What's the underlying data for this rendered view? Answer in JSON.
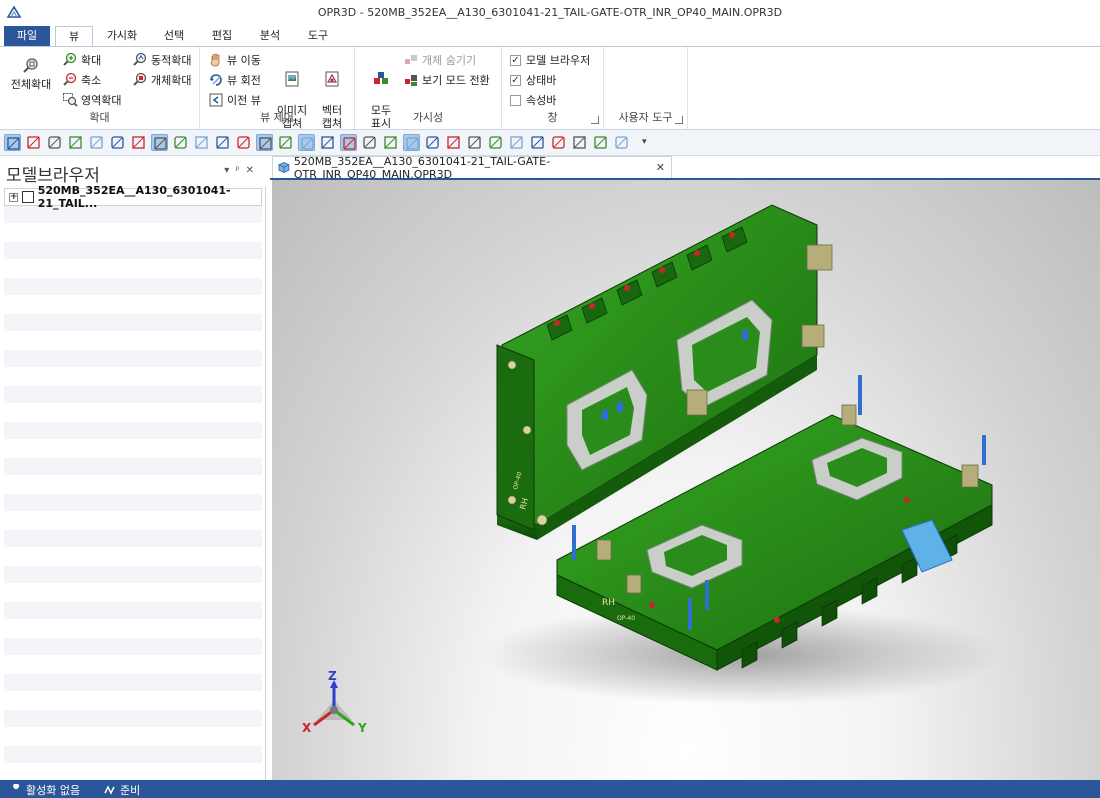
{
  "window": {
    "title": "OPR3D - 520MB_352EA__A130_6301041-21_TAIL-GATE-OTR_INR_OP40_MAIN.OPR3D"
  },
  "ribbon_tabs": [
    {
      "label": "파일"
    },
    {
      "label": "뷰"
    },
    {
      "label": "가시화"
    },
    {
      "label": "선택"
    },
    {
      "label": "편집"
    },
    {
      "label": "분석"
    },
    {
      "label": "도구"
    }
  ],
  "active_tab": "뷰",
  "groups": {
    "zoom": {
      "label": "확대",
      "fit_all": "전체확대",
      "zoom_in": "확대",
      "zoom_out": "축소",
      "zoom_area": "영역확대",
      "dynamic_zoom": "동적확대",
      "zoom_object": "개체확대"
    },
    "view_control": {
      "label": "뷰 제어",
      "pan": "뷰 이동",
      "rotate": "뷰 회전",
      "previous": "이전 뷰",
      "image_capture": "이미지\n캡쳐",
      "vector_capture": "벡터\n캡쳐"
    },
    "visibility": {
      "label": "가시성",
      "show_all": "모두\n표시",
      "hide_object": "개체 숨기기",
      "view_mode": "보기 모드 전환"
    },
    "window": {
      "label": "창",
      "model_browser": "모델 브라우저",
      "model_browser_checked": true,
      "status_bar": "상태바",
      "status_bar_checked": true,
      "property_bar": "속성바",
      "property_bar_checked": false
    },
    "user_tools": {
      "label": "사용자 도구"
    }
  },
  "panel": {
    "title": "모델브라우저",
    "tree_root": "520MB_352EA__A130_6301041-21_TAIL..."
  },
  "document": {
    "tab_label": "520MB_352EA__A130_6301041-21_TAIL-GATE-OTR_INR_OP40_MAIN.OPR3D"
  },
  "viewport": {
    "axes": {
      "x": "X",
      "y": "Y",
      "z": "Z"
    },
    "model_text": {
      "rh_top": "RH",
      "op_top": "OP-40",
      "rh_bottom": "RH",
      "op_bottom": "OP-40"
    },
    "colors": {
      "fixture": "#1f7a12",
      "fixture_light": "#2fa51c",
      "fixture_dark": "#0e4a08",
      "accent_blue": "#2f6fd0",
      "accent_red": "#c8262a",
      "panel_silver": "#c9cfc8"
    }
  },
  "statusbar": {
    "activation": "활성화 없음",
    "ready": "준비"
  },
  "icons": [
    "app-logo-icon",
    "fit-all-icon",
    "zoom-in-icon",
    "zoom-out-icon",
    "zoom-area-icon",
    "dynamic-zoom-icon",
    "zoom-object-icon",
    "pan-icon",
    "rotate-icon",
    "previous-view-icon",
    "image-capture-icon",
    "vector-capture-icon",
    "show-all-icon",
    "hide-object-icon",
    "view-mode-icon",
    "wrench-icon",
    "ready-icon"
  ]
}
